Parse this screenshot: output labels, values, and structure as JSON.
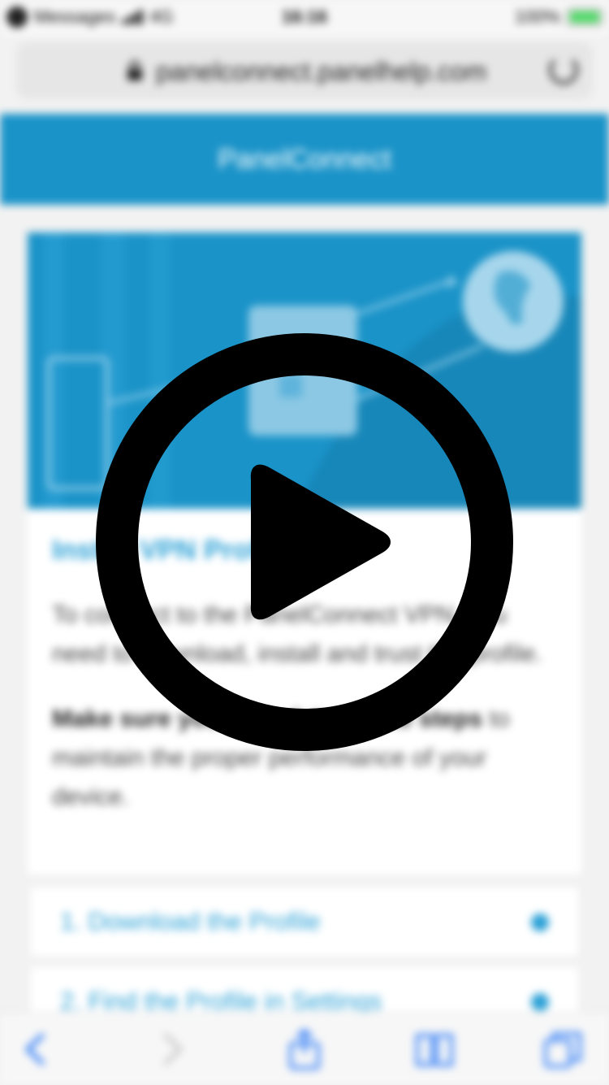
{
  "status_bar": {
    "carrier": "Messages",
    "network": "4G",
    "time": "16:16",
    "battery": "100%"
  },
  "browser": {
    "url": "panelconnect.panelhelp.com"
  },
  "header": {
    "title": "PanelConnect"
  },
  "card": {
    "title": "Install VPN Profile",
    "intro": "To connect to the PanelConnect VPN, you need to download, install and trust the profile.",
    "warning_bold": "Make sure you complete all the steps",
    "warning_rest": " to maintain the proper performance of your device."
  },
  "steps": [
    {
      "label": "1. Download the Profile"
    },
    {
      "label": "2. Find the Profile in Settings"
    }
  ],
  "toolbar": {
    "icons": [
      "back-icon",
      "forward-icon",
      "share-icon",
      "bookmarks-icon",
      "tabs-icon"
    ]
  },
  "overlay": {
    "icon": "play-icon"
  },
  "colors": {
    "accent": "#1a93c8",
    "link": "#2aa0d6",
    "ios_blue": "#2f7cf6"
  }
}
